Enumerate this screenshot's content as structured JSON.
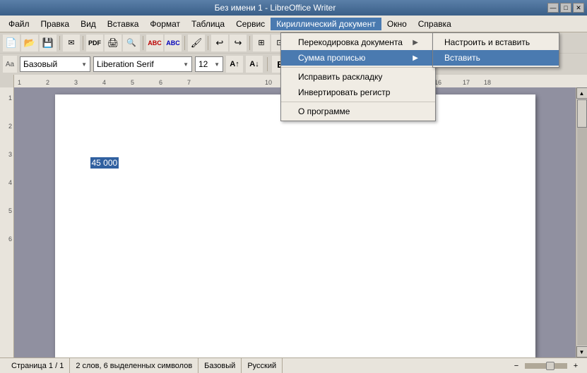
{
  "titlebar": {
    "title": "Без имени 1 - LibreOffice Writer",
    "min_btn": "—",
    "max_btn": "□",
    "close_btn": "✕"
  },
  "menubar": {
    "items": [
      {
        "label": "Файл",
        "id": "file"
      },
      {
        "label": "Правка",
        "id": "edit"
      },
      {
        "label": "Вид",
        "id": "view"
      },
      {
        "label": "Вставка",
        "id": "insert"
      },
      {
        "label": "Формат",
        "id": "format"
      },
      {
        "label": "Таблица",
        "id": "table"
      },
      {
        "label": "Сервис",
        "id": "tools"
      },
      {
        "label": "Кириллический документ",
        "id": "cyrillic",
        "active": true
      },
      {
        "label": "Окно",
        "id": "window"
      },
      {
        "label": "Справка",
        "id": "help"
      }
    ]
  },
  "toolbar": {
    "style_value": "Базовый",
    "style_placeholder": "Базовый",
    "font_value": "Liberation Serif",
    "font_placeholder": "Liberation Serif",
    "size_value": "12"
  },
  "dropdown_cyrillic": {
    "items": [
      {
        "label": "Перекодировка документа",
        "id": "recode",
        "has_submenu": true
      },
      {
        "label": "Сумма прописью",
        "id": "summa",
        "has_submenu": true,
        "active": true
      },
      {
        "label": "Исправить раскладку",
        "id": "fix_layout",
        "has_submenu": false
      },
      {
        "label": "Инвертировать регистр",
        "id": "invert_case",
        "has_submenu": false
      },
      {
        "label": "О программе",
        "id": "about",
        "has_submenu": false
      }
    ]
  },
  "submenu_summa": {
    "items": [
      {
        "label": "Настроить и вставить",
        "id": "configure_insert"
      },
      {
        "label": "Вставить",
        "id": "insert_only",
        "highlighted": true
      }
    ]
  },
  "document": {
    "content": "45 000",
    "content_selected": true
  },
  "statusbar": {
    "page_info": "Страница 1 / 1",
    "words_info": "2 слов, 6 выделенных символов",
    "style_info": "Базовый",
    "lang_info": "Русский"
  },
  "colors": {
    "active_menu_bg": "#4a7ab0",
    "menu_bar_bg": "#e8e4dc",
    "dropdown_bg": "#f0ece4",
    "selected_bg": "#3060a0",
    "titlebar_gradient_start": "#5a7fa8",
    "titlebar_gradient_end": "#3a5f88"
  }
}
